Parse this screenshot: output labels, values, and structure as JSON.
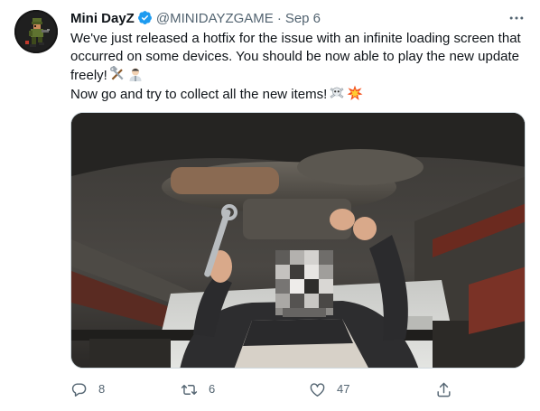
{
  "author": {
    "name": "Mini DayZ",
    "handle": "@MINIDAYZGAME",
    "separator": "·",
    "date": "Sep 6"
  },
  "tweet": {
    "line1": "We've just released a hotfix for the issue with an infinite loading screen that occurred on some devices. You should be now able to play the new update freely!",
    "line2": "Now go and try to collect all the new items!"
  },
  "stats": {
    "replies": "8",
    "retweets": "6",
    "likes": "47"
  },
  "icons": {
    "avatar": "soldier-avatar",
    "verified": "verified-badge-icon",
    "more": "more-icon",
    "emoji1": "hammer-and-wrench-emoji",
    "emoji2": "mechanic-emoji",
    "emoji3": "skull-and-crossbones-emoji",
    "emoji4": "collision-emoji",
    "reply": "reply-icon",
    "retweet": "retweet-icon",
    "like": "like-icon",
    "share": "share-icon"
  },
  "colors": {
    "verified": "#1d9bf0",
    "text": "#0f1419",
    "muted": "#536471",
    "border": "#cfd9de"
  }
}
